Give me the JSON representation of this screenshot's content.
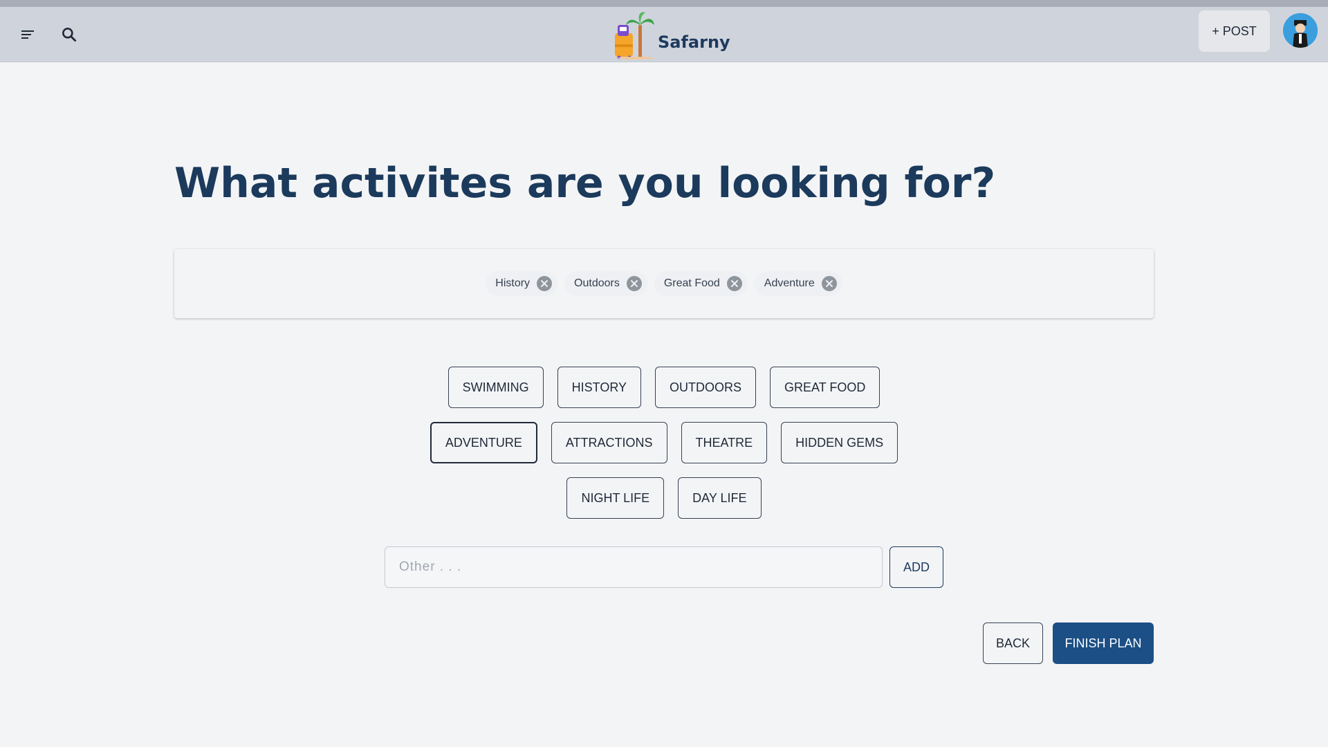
{
  "header": {
    "brand": "Safarny",
    "post_label": "+ POST"
  },
  "page": {
    "title": "What activites are you looking for?"
  },
  "selected_chips": [
    {
      "label": "History"
    },
    {
      "label": "Outdoors"
    },
    {
      "label": "Great Food"
    },
    {
      "label": "Adventure"
    }
  ],
  "options": {
    "row1": [
      "SWIMMING",
      "HISTORY",
      "OUTDOORS",
      "GREAT FOOD"
    ],
    "row2": [
      "ADVENTURE",
      "ATTRACTIONS",
      "THEATRE",
      "HIDDEN GEMS"
    ],
    "row3": [
      "NIGHT LIFE",
      "DAY LIFE"
    ]
  },
  "other": {
    "placeholder": "Other . . .",
    "value": "",
    "add_label": "ADD"
  },
  "actions": {
    "back_label": "BACK",
    "finish_label": "FINISH PLAN"
  },
  "colors": {
    "primary": "#1b4f85",
    "title": "#1b3a5c",
    "header_bg": "#cfd4dc",
    "page_bg": "#f3f4f6",
    "avatar_bg": "#3b9ede"
  },
  "icons": {
    "menu": "menu-icon",
    "search": "search-icon",
    "chip_remove": "close-circle-icon",
    "logo": "palm-suitcase-logo",
    "avatar": "user-avatar"
  }
}
